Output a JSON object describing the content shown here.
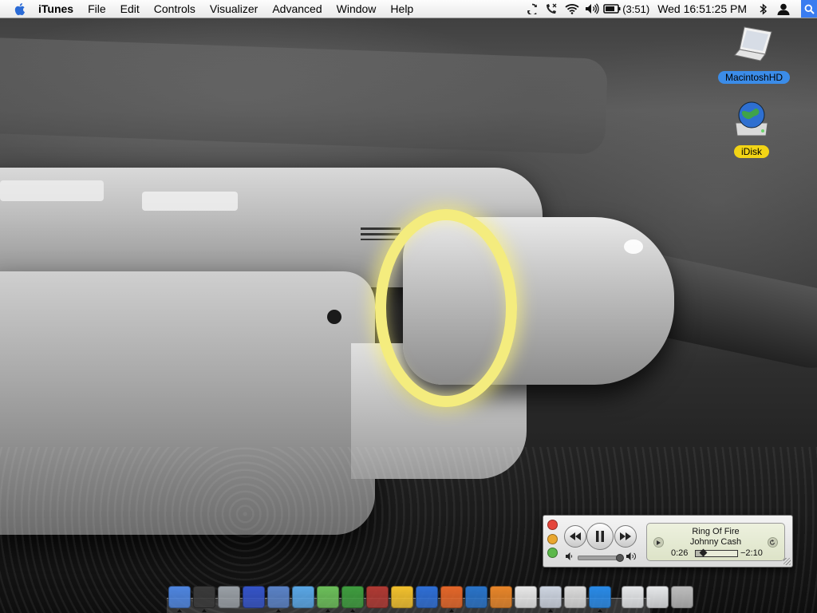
{
  "menubar": {
    "app_name": "iTunes",
    "menus": [
      "File",
      "Edit",
      "Controls",
      "Visualizer",
      "Advanced",
      "Window",
      "Help"
    ],
    "battery_time": "(3:51)",
    "clock": "Wed 16:51:25 PM",
    "status_icons": [
      "sync-icon",
      "phone-icon",
      "wifi-icon",
      "volume-icon",
      "battery-icon",
      "bluetooth-icon",
      "user-icon",
      "spotlight-icon"
    ]
  },
  "desktop_icons": [
    {
      "label": "MacintoshHD",
      "icon": "laptop-icon",
      "label_color": "#3b8ce8"
    },
    {
      "label": "iDisk",
      "icon": "idisk-icon",
      "label_color": "#f2d415"
    }
  ],
  "mini_player": {
    "track_title": "Ring Of Fire",
    "artist": "Johnny Cash",
    "elapsed": "0:26",
    "remaining": "−2:10",
    "progress_fraction": 0.17,
    "volume_fraction": 0.95,
    "state": "playing"
  },
  "dock": {
    "items": [
      {
        "name": "finder",
        "color": "#4f86e0",
        "running": true
      },
      {
        "name": "dashboard",
        "color": "#3a3a3a",
        "running": true
      },
      {
        "name": "system-preferences",
        "color": "#9aa0a6",
        "running": false
      },
      {
        "name": "display-app",
        "color": "#3554c8",
        "running": false
      },
      {
        "name": "mail",
        "color": "#5b83c7",
        "running": true
      },
      {
        "name": "safari",
        "color": "#5aa7e6",
        "running": false
      },
      {
        "name": "itunes",
        "color": "#6cbf5a",
        "running": true
      },
      {
        "name": "chameleon-app",
        "color": "#3f9d3f",
        "running": true
      },
      {
        "name": "utility-app",
        "color": "#b03a34",
        "running": false
      },
      {
        "name": "adium",
        "color": "#f2c12e",
        "running": false
      },
      {
        "name": "network-app",
        "color": "#2f6fd6",
        "running": false
      },
      {
        "name": "firefox",
        "color": "#e4672a",
        "running": true
      },
      {
        "name": "m-app",
        "color": "#2a74c9",
        "running": false
      },
      {
        "name": "umbrella-app",
        "color": "#e8862a",
        "running": false
      },
      {
        "name": "textedit",
        "color": "#e9e9e9",
        "running": false
      },
      {
        "name": "preview",
        "color": "#cfd6e2",
        "running": true
      },
      {
        "name": "notes-app",
        "color": "#dcdcdc",
        "running": false
      },
      {
        "name": "quicktime",
        "color": "#2a8be8",
        "running": true
      }
    ],
    "right_items": [
      {
        "name": "minimized-window-1",
        "color": "#e6e8ea"
      },
      {
        "name": "minimized-window-2",
        "color": "#e6e8ea"
      },
      {
        "name": "trash",
        "color": "#bdbdbd"
      }
    ]
  }
}
